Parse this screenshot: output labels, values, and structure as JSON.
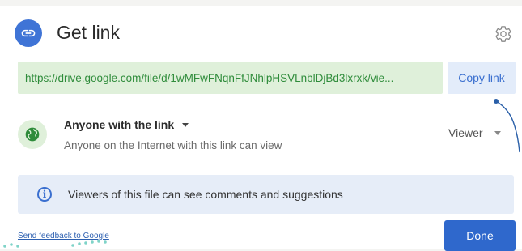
{
  "header": {
    "title": "Get link",
    "icon": "link-icon",
    "settings_icon": "gear-icon"
  },
  "link": {
    "url": "https://drive.google.com/file/d/1wMFwFNqnFfJNhlpHSVLnblDjBd3lxrxk/vie...",
    "copy_label": "Copy link"
  },
  "access": {
    "icon": "globe-icon",
    "title": "Anyone with the link",
    "subtitle": "Anyone on the Internet with this link can view",
    "role": "Viewer"
  },
  "banner": {
    "icon": "info-icon",
    "text": "Viewers of this file can see comments and suggestions"
  },
  "footer": {
    "feedback_label": "Send feedback to Google",
    "done_label": "Done"
  },
  "colors": {
    "accent": "#2f68cc",
    "link_green": "#2f8c3b",
    "link_bg": "#dff0da",
    "banner_bg": "#e6edf8"
  }
}
